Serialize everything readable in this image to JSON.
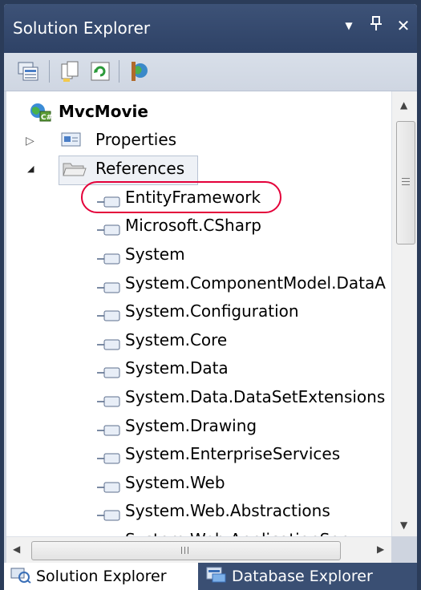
{
  "panel": {
    "title": "Solution Explorer",
    "buttons": {
      "dropdown": "▼",
      "pin": "ᵽ",
      "close": "✕"
    }
  },
  "toolbar": {
    "icons": [
      "properties-icon",
      "show-all-files-icon",
      "refresh-icon",
      "class-view-icon"
    ]
  },
  "tree": {
    "project": "MvcMovie",
    "items": [
      {
        "label": "Properties",
        "expander": "▷"
      },
      {
        "label": "References",
        "expander": "◢"
      },
      {
        "label": "EntityFramework"
      },
      {
        "label": "Microsoft.CSharp"
      },
      {
        "label": "System"
      },
      {
        "label": "System.ComponentModel.DataA"
      },
      {
        "label": "System.Configuration"
      },
      {
        "label": "System.Core"
      },
      {
        "label": "System.Data"
      },
      {
        "label": "System.Data.DataSetExtensions"
      },
      {
        "label": "System.Drawing"
      },
      {
        "label": "System.EnterpriseServices"
      },
      {
        "label": "System.Web"
      },
      {
        "label": "System.Web.Abstractions"
      },
      {
        "label": "System.Web.ApplicationServ"
      }
    ]
  },
  "bottom_tabs": [
    {
      "label": "Solution Explorer",
      "active": true
    },
    {
      "label": "Database Explorer",
      "active": false
    }
  ],
  "colors": {
    "highlight_circle": "#e4003a",
    "title_bg": "#2e4266"
  }
}
